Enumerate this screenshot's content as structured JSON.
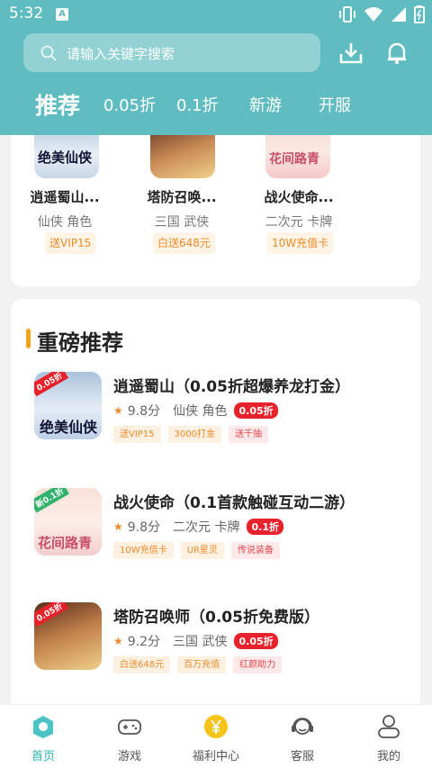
{
  "status_bar": {
    "time": "5:32",
    "notif_letter": "A"
  },
  "search": {
    "placeholder": "请输入关键字搜索"
  },
  "header_icons": {
    "download": "download-icon",
    "bell": "bell-icon"
  },
  "tabs": [
    "推荐",
    "0.05折",
    "0.1折",
    "新游",
    "开服"
  ],
  "top_games": [
    {
      "name": "逍遥蜀山...",
      "tags": "仙侠 角色",
      "badge": "送VIP15",
      "icon_text": "绝美仙侠"
    },
    {
      "name": "塔防召唤...",
      "tags": "三国 武侠",
      "badge": "白送648元",
      "icon_text": ""
    },
    {
      "name": "战火使命...",
      "tags": "二次元 卡牌",
      "badge": "10W充值卡",
      "icon_text": "花间路青"
    }
  ],
  "section": {
    "title": "重磅推荐"
  },
  "games": [
    {
      "name": "逍遥蜀山（0.05折超爆养龙打金）",
      "score": "9.8分",
      "tags": "仙侠 角色",
      "discount": "0.05折",
      "badges": [
        "送VIP15",
        "3000打金",
        "送千抽"
      ],
      "corner": "0.05折",
      "icon_text": "绝美仙侠"
    },
    {
      "name": "战火使命（0.1首款触碰互动二游）",
      "score": "9.8分",
      "tags": "二次元 卡牌",
      "discount": "0.1折",
      "badges": [
        "10W充值卡",
        "UR星灵",
        "传说装备"
      ],
      "corner": "新0.1折",
      "icon_text": "花间路青"
    },
    {
      "name": "塔防召唤师（0.05折免费版）",
      "score": "9.2分",
      "tags": "三国 武侠",
      "discount": "0.05折",
      "badges": [
        "白送648元",
        "百万充值",
        "红颜助力"
      ],
      "corner": "0.05折",
      "icon_text": ""
    }
  ],
  "nav": [
    {
      "label": "首页",
      "icon": "home-icon",
      "active": true
    },
    {
      "label": "游戏",
      "icon": "gamepad-icon",
      "active": false
    },
    {
      "label": "福利中心",
      "icon": "yen-coin-icon",
      "active": false
    },
    {
      "label": "客服",
      "icon": "headset-icon",
      "active": false
    },
    {
      "label": "我的",
      "icon": "user-icon",
      "active": false
    }
  ],
  "colors": {
    "header": "#5fbcc0",
    "accent": "#2fb2b8",
    "orange": "#f08a2a",
    "red": "#e8212a"
  }
}
